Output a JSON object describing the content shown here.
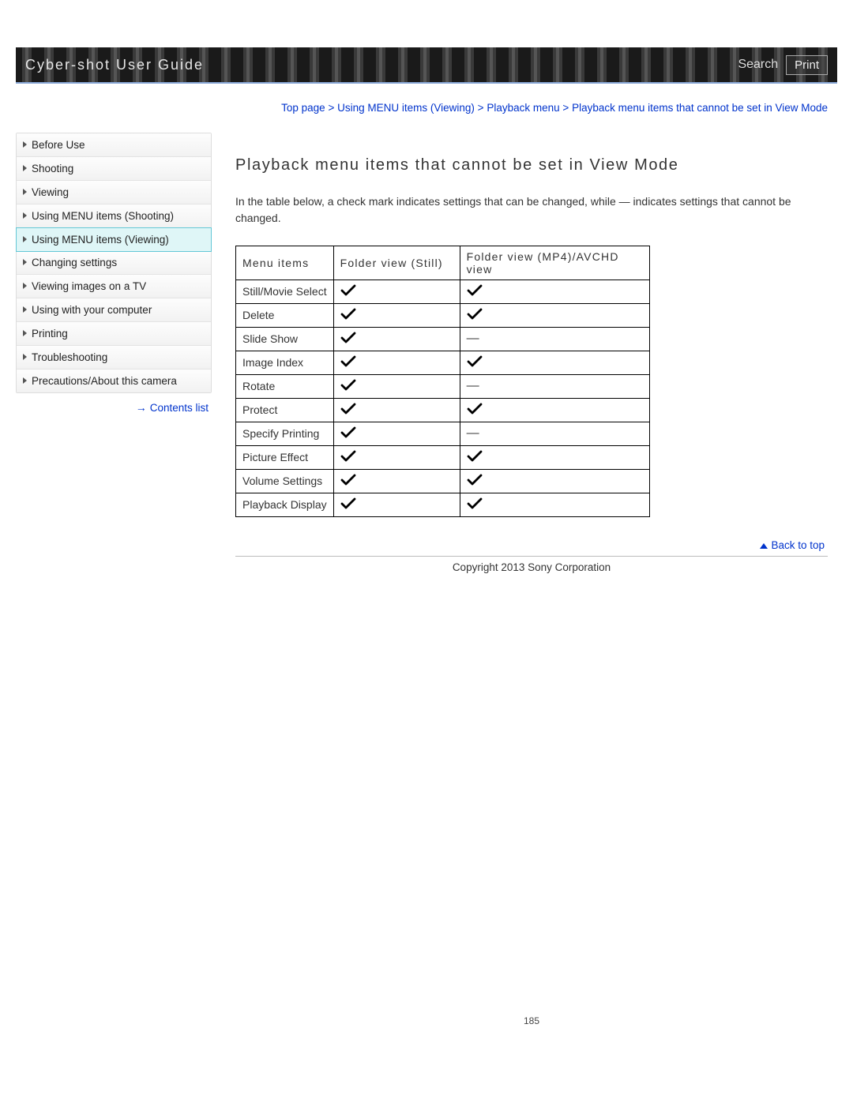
{
  "header": {
    "title": "Cyber-shot User Guide",
    "search_label": "Search",
    "print_label": "Print"
  },
  "breadcrumb": {
    "items": [
      "Top page",
      "Using MENU items (Viewing)",
      "Playback menu",
      "Playback menu items that cannot be set in View Mode"
    ],
    "sep": ">"
  },
  "sidebar": {
    "items": [
      {
        "label": "Before Use",
        "active": false
      },
      {
        "label": "Shooting",
        "active": false
      },
      {
        "label": "Viewing",
        "active": false
      },
      {
        "label": "Using MENU items (Shooting)",
        "active": false
      },
      {
        "label": "Using MENU items (Viewing)",
        "active": true
      },
      {
        "label": "Changing settings",
        "active": false
      },
      {
        "label": "Viewing images on a TV",
        "active": false
      },
      {
        "label": "Using with your computer",
        "active": false
      },
      {
        "label": "Printing",
        "active": false
      },
      {
        "label": "Troubleshooting",
        "active": false
      },
      {
        "label": "Precautions/About this camera",
        "active": false
      }
    ],
    "contents_link": "Contents list"
  },
  "main": {
    "heading": "Playback menu items that cannot be set in View Mode",
    "intro": "In the table below, a check mark indicates settings that can be changed, while — indicates settings that cannot be changed.",
    "table": {
      "headers": [
        "Menu items",
        "Folder view (Still)",
        "Folder view (MP4)/AVCHD view"
      ],
      "rows": [
        {
          "label": "Still/Movie Select",
          "still": "check",
          "mp4": "check"
        },
        {
          "label": "Delete",
          "still": "check",
          "mp4": "check"
        },
        {
          "label": "Slide Show",
          "still": "check",
          "mp4": "dash"
        },
        {
          "label": "Image Index",
          "still": "check",
          "mp4": "check"
        },
        {
          "label": "Rotate",
          "still": "check",
          "mp4": "dash"
        },
        {
          "label": "Protect",
          "still": "check",
          "mp4": "check"
        },
        {
          "label": "Specify Printing",
          "still": "check",
          "mp4": "dash"
        },
        {
          "label": "Picture Effect",
          "still": "check",
          "mp4": "check"
        },
        {
          "label": "Volume Settings",
          "still": "check",
          "mp4": "check"
        },
        {
          "label": "Playback Display",
          "still": "check",
          "mp4": "check"
        }
      ]
    },
    "back_to_top": "Back to top"
  },
  "footer": {
    "copyright": "Copyright 2013 Sony Corporation",
    "page_number": "185"
  },
  "symbols": {
    "dash": "—"
  }
}
